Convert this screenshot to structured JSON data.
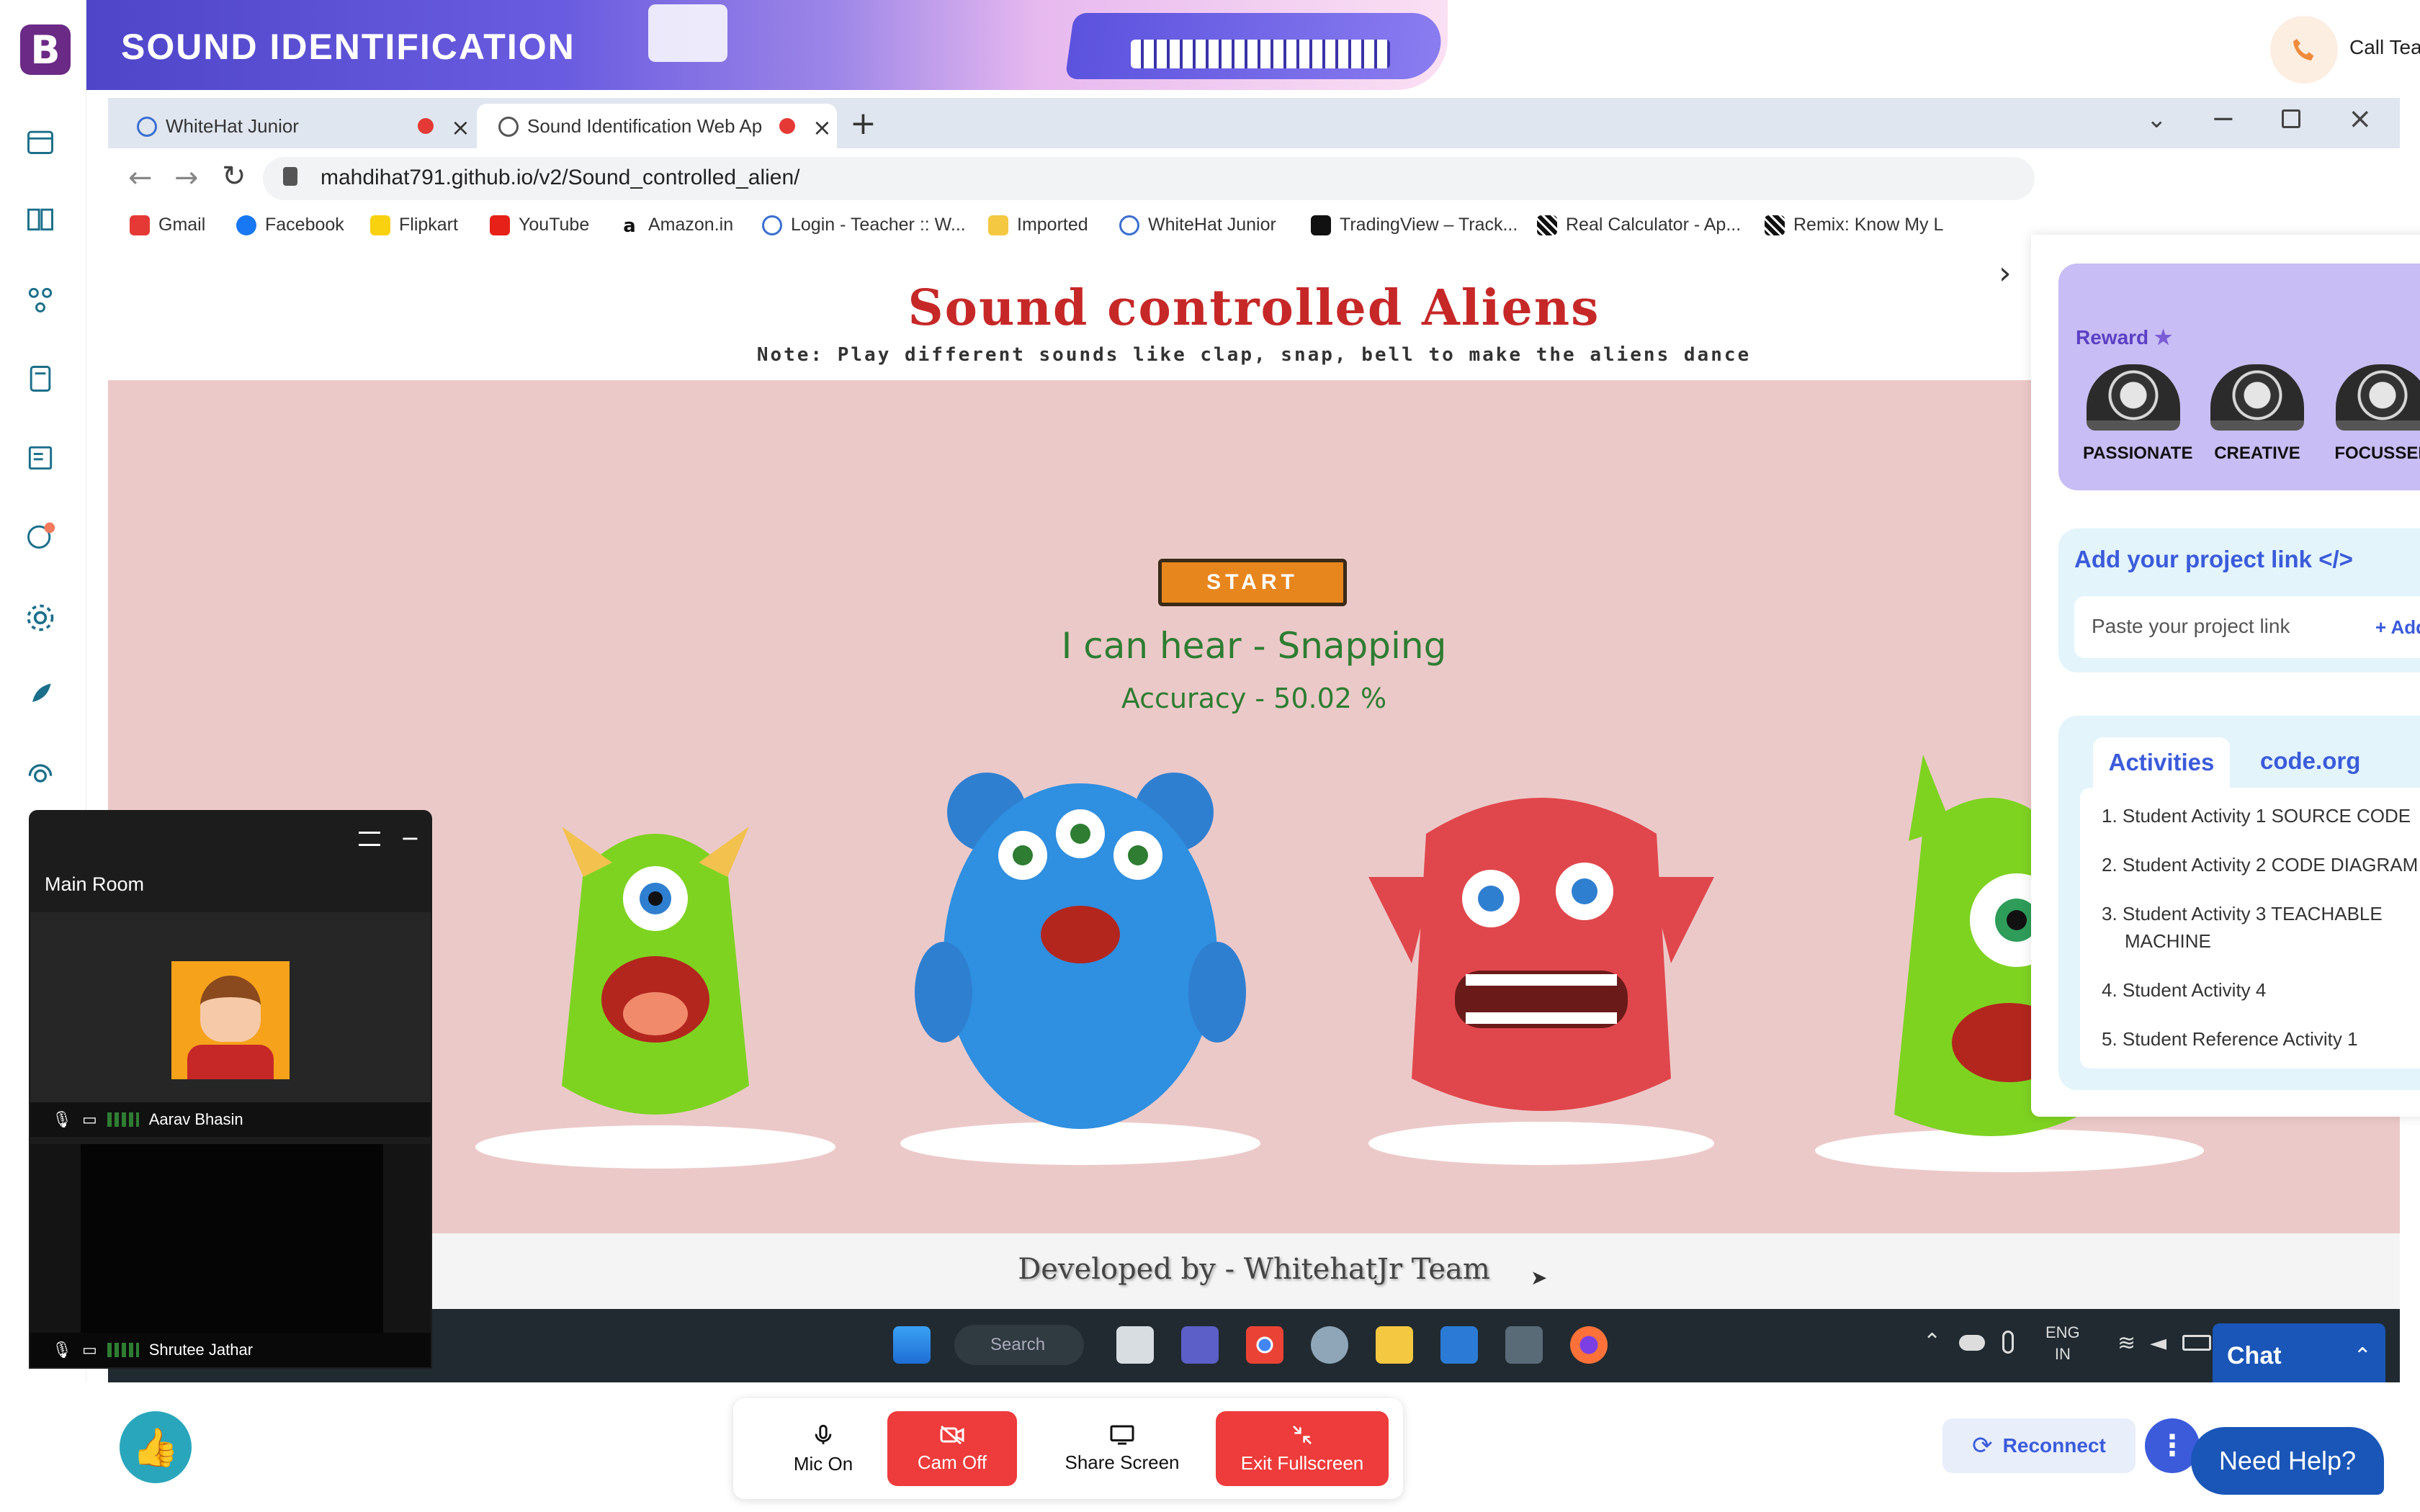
{
  "header": {
    "banner_title": "SOUND IDENTIFICATION",
    "call_teacher": "Call Teacher"
  },
  "browser": {
    "tabs": [
      {
        "label": "WhiteHat Junior"
      },
      {
        "label": "Sound Identification Web Ap"
      }
    ],
    "url": "mahdihat791.github.io/v2/Sound_controlled_alien/",
    "bookmarks": [
      "Gmail",
      "Facebook",
      "Flipkart",
      "YouTube",
      "Amazon.in",
      "Login - Teacher :: W...",
      "Imported",
      "WhiteHat Junior",
      "TradingView – Track...",
      "Real Calculator - Ap...",
      "Remix: Know My L"
    ]
  },
  "page": {
    "title": "Sound controlled Aliens",
    "note": "Note: Play different sounds like clap, snap, bell to make the aliens dance",
    "start_label": "START",
    "hear_text": "I can hear - Snapping",
    "accuracy_text": "Accuracy - 50.02 %",
    "footer_text": "Developed by - WhitehatJr Team"
  },
  "taskbar": {
    "search_placeholder": "Search",
    "lang": "ENG",
    "region": "IN"
  },
  "panel": {
    "reward_label": "Reward",
    "badges": [
      "PASSIONATE",
      "CREATIVE",
      "FOCUSSED"
    ],
    "project_title": "Add your project link </>",
    "project_placeholder": "Paste your project link",
    "project_add": "+ Add",
    "tabs": [
      "Activities",
      "code.org"
    ],
    "activities": [
      "1. Student Activity 1 SOURCE CODE",
      "2. Student Activity 2 CODE DIAGRAM",
      "3. Student Activity 3 TEACHABLE MACHINE",
      "4. Student Activity 4",
      "5. Student Reference Activity 1"
    ]
  },
  "video": {
    "room": "Main Room",
    "participants": [
      "Aarav Bhasin",
      "Shrutee Jathar"
    ]
  },
  "bottom": {
    "mic": "Mic On",
    "cam": "Cam Off",
    "share": "Share Screen",
    "exit": "Exit Fullscreen",
    "reconnect": "Reconnect",
    "need_help": "Need Help?",
    "chat": "Chat"
  },
  "colors": {
    "brand_purple": "#6b2a86",
    "accent_blue": "#3b5bdb",
    "danger_red": "#ee3b3b",
    "page_pink": "#ecc9c9"
  }
}
